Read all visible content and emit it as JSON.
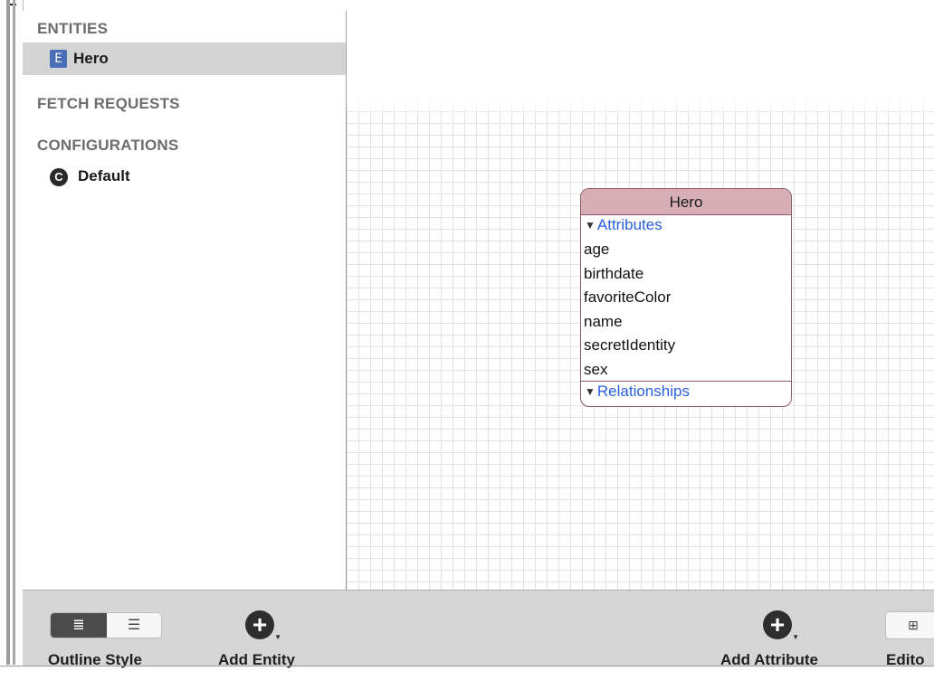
{
  "sidebar": {
    "entities_header": "ENTITIES",
    "entities": [
      {
        "badge": "E",
        "label": "Hero",
        "selected": true
      }
    ],
    "fetch_requests_header": "FETCH REQUESTS",
    "configurations_header": "CONFIGURATIONS",
    "configurations": [
      {
        "badge": "C",
        "label": "Default"
      }
    ]
  },
  "diagram": {
    "entity": {
      "title": "Hero",
      "attributes_label": "Attributes",
      "attributes": [
        "age",
        "birthdate",
        "favoriteColor",
        "name",
        "secretIdentity",
        "sex"
      ],
      "relationships_label": "Relationships"
    }
  },
  "toolbar": {
    "outline_style_label": "Outline Style",
    "add_entity_label": "Add Entity",
    "add_attribute_label": "Add Attribute",
    "editor_label": "Edito"
  },
  "colors": {
    "entity_header": "#d7aeb6",
    "entity_border": "#8e5a66",
    "link_blue": "#2a5fe0",
    "selection_gray": "#d4d4d4",
    "toolbar_bg": "#d6d6d6"
  },
  "icons": {
    "entity_badge": "entity-e-icon",
    "configuration_badge": "configuration-c-icon",
    "add": "plus-circle-icon",
    "outline_list": "list-style-icon",
    "graph_style": "hierarchy-style-icon",
    "editor_table": "table-icon"
  }
}
